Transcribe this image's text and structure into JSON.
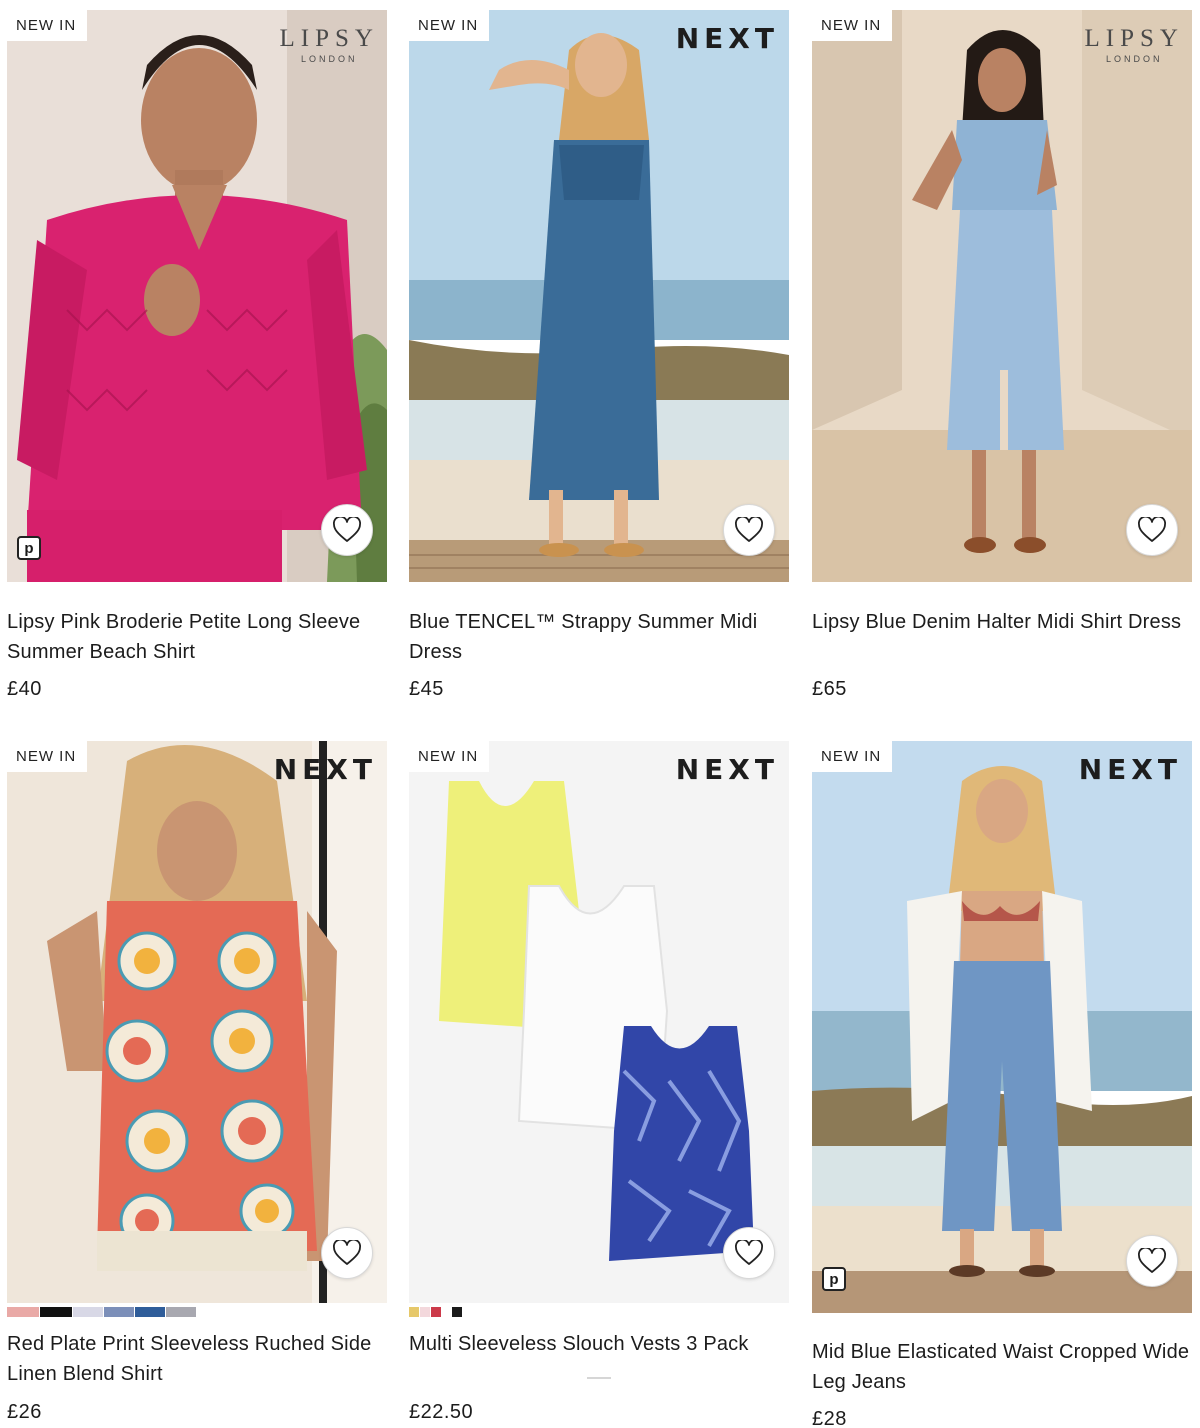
{
  "products": [
    {
      "badge": "NEW IN",
      "brand": "LIPSY",
      "brand_sub": "LONDON",
      "title": "Lipsy Pink Broderie Petite Long Sleeve Summer Beach Shirt",
      "price": "£40",
      "pay_icon": "p"
    },
    {
      "badge": "NEW IN",
      "brand": "NEXT",
      "title": "Blue TENCEL™ Strappy Summer Midi Dress",
      "price": "£45"
    },
    {
      "badge": "NEW IN",
      "brand": "LIPSY",
      "brand_sub": "LONDON",
      "title": "Lipsy Blue Denim Halter Midi Shirt Dress",
      "price": "£65"
    },
    {
      "badge": "NEW IN",
      "brand": "NEXT",
      "title": "Red Plate Print Sleeveless Ruched Side Linen Blend Shirt",
      "price": "£26",
      "swatch_colors": [
        "#e9a9a6",
        "#111111",
        "#d8d8e6",
        "#7c8fb9",
        "#2f5d9a",
        "#a8a8b0"
      ]
    },
    {
      "badge": "NEW IN",
      "brand": "NEXT",
      "title": "Multi Sleeveless Slouch Vests 3 Pack",
      "price": "£22.50",
      "swatch_colors": [
        "#e6c86a",
        "#f3d8dc",
        "#cc3a4a",
        "#1b1b1b"
      ]
    },
    {
      "badge": "NEW IN",
      "brand": "NEXT",
      "title": "Mid Blue Elasticated Waist Cropped Wide Leg Jeans",
      "price": "£28",
      "pay_icon": "p"
    }
  ],
  "icons": {
    "favourite": "heart-outline-icon",
    "pay_later": "p-payment-icon"
  },
  "colors": {
    "text": "#1c1c1c",
    "badge_bg": "#ffffff"
  }
}
